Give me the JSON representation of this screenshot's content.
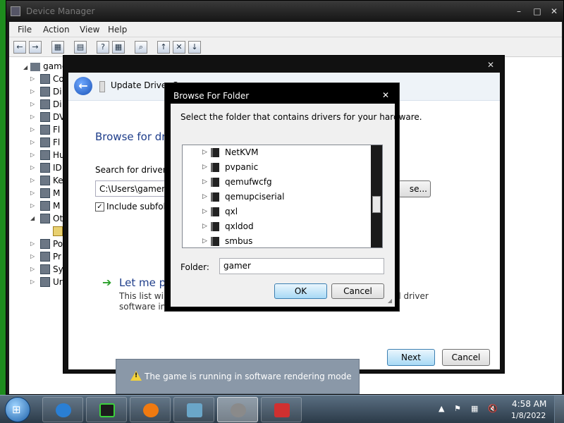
{
  "device_manager": {
    "title": "Device Manager",
    "menu": [
      "File",
      "Action",
      "View",
      "Help"
    ],
    "tree_root": "game",
    "tree_items": [
      "Co",
      "Di",
      "Di",
      "DV",
      "Fl",
      "Fl",
      "Hu",
      "ID",
      "Ke",
      "M",
      "M",
      "Ot",
      "",
      "Po",
      "Pr",
      "Sy",
      "Ur"
    ]
  },
  "wizard": {
    "title": "Update Driver S… Software – Gamer-PC",
    "title_short": "Update Driver S",
    "heading": "Browse for dri",
    "search_label": "Search for driver so",
    "path_value": "C:\\Users\\gamer\\D",
    "browse_label": "se...",
    "include_subfolders": "Include subfold",
    "include_checked": "✓",
    "letme_title": "Let me pi",
    "desc_line1": "This list will s",
    "desc_line2": "software in t",
    "desc_right": "ll driver",
    "next_label": "Next",
    "cancel_label": "Cancel",
    "close": "✕"
  },
  "browse_folder": {
    "title": "Browse For Folder",
    "message": "Select the folder that contains drivers for your hardware.",
    "items": [
      "NetKVM",
      "pvpanic",
      "qemufwcfg",
      "qemupciserial",
      "qxl",
      "qxldod",
      "smbus"
    ],
    "folder_label": "Folder:",
    "folder_value": "gamer",
    "ok_label": "OK",
    "cancel_label": "Cancel",
    "close": "✕"
  },
  "toast": {
    "text": "The game is running in software rendering mode",
    "icon": "warning-icon"
  },
  "taskbar": {
    "time": "4:58 AM",
    "date": "1/8/2022",
    "buttons": [
      "internet-explorer-icon",
      "nvidia-icon",
      "media-player-icon",
      "notepad-icon",
      "settings-gear-icon",
      "toolbox-icon"
    ],
    "colors": {
      "ie": "#2a7fd4",
      "nvidia": "#1c1c1c",
      "media": "#f07a10",
      "notepad": "#6aa6c8",
      "gear": "#8a8a8a",
      "toolbox": "#d03030"
    }
  }
}
